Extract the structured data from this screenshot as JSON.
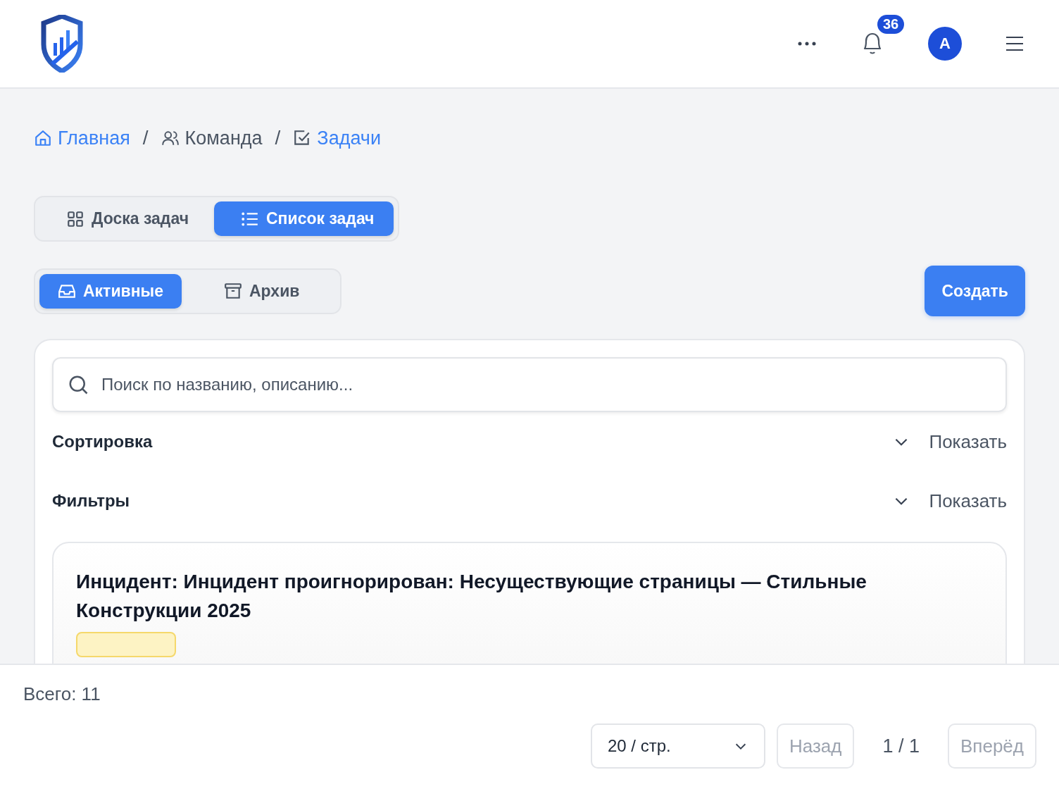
{
  "header": {
    "notifications": {
      "count": "36"
    },
    "avatar": {
      "initial": "A"
    }
  },
  "breadcrumb": [
    {
      "label": "Главная",
      "link": true
    },
    {
      "label": "Команда",
      "link": false
    },
    {
      "label": "Задачи",
      "link": true
    }
  ],
  "separator": "/",
  "view_tabs": [
    {
      "label": "Доска задач",
      "selected": false
    },
    {
      "label": "Список задач",
      "selected": true
    }
  ],
  "status_tabs": [
    {
      "label": "Активные",
      "selected": true
    },
    {
      "label": "Архив",
      "selected": false
    }
  ],
  "create_button": "Создать",
  "search": {
    "placeholder": "Поиск по названию, описанию..."
  },
  "sections": [
    {
      "title": "Сортировка",
      "toggle": "Показать"
    },
    {
      "title": "Фильтры",
      "toggle": "Показать"
    }
  ],
  "tasks": [
    {
      "title": "Инцидент: Инцидент проигнорирован: Несуществующие страницы — Стильные Конструкции 2025"
    }
  ],
  "footer": {
    "total": "Всего: 11",
    "page_size": "20 / стр.",
    "prev": {
      "label": "Назад",
      "disabled": true
    },
    "page": "1 / 1",
    "next": {
      "label": "Вперёд",
      "disabled": true
    }
  }
}
